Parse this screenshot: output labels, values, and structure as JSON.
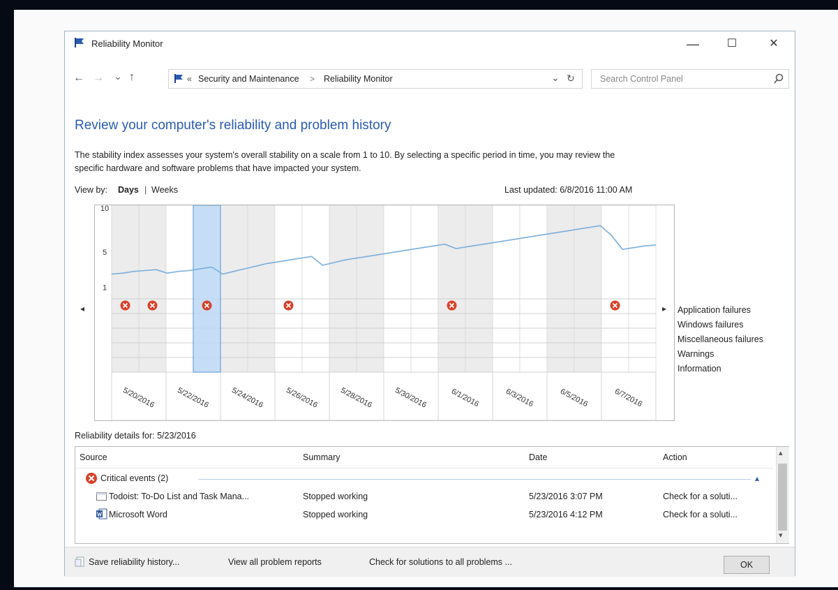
{
  "window": {
    "title": "Reliability Monitor",
    "minimize": "—",
    "maximize": "☐",
    "close": "✕"
  },
  "nav": {
    "back": "←",
    "forward": "→",
    "recent": "⌄",
    "up": "↑",
    "breadcrumb": [
      "Security and Maintenance",
      "Reliability Monitor"
    ],
    "breadcrumb_prefix": "«",
    "separator": ">",
    "dropdown": "⌄",
    "refresh": "↻",
    "search_placeholder": "Search Control Panel"
  },
  "page": {
    "heading": "Review your computer's reliability and problem history",
    "description_line1": "The stability index assesses your system's overall stability on a scale from 1 to 10. By selecting a specific period in time, you may review the",
    "description_line2": "specific hardware and software problems that have impacted your system.",
    "view_by_label": "View by:",
    "view_days": "Days",
    "view_sep": "|",
    "view_weeks": "Weeks",
    "last_updated": "Last updated: 6/8/2016 11:00 AM"
  },
  "chart_data": {
    "type": "line",
    "ylim": [
      0,
      10
    ],
    "y_ticks": [
      "10",
      "5",
      "1"
    ],
    "x_tick_labels": [
      "5/20/2016",
      "5/22/2016",
      "5/24/2016",
      "5/26/2016",
      "5/28/2016",
      "5/30/2016",
      "6/1/2016",
      "6/3/2016",
      "6/5/2016",
      "6/7/2016"
    ],
    "selected_date": "5/23/2016",
    "series": [
      {
        "values": [
          2.5,
          2.6,
          2.8,
          2.9,
          3.0,
          2.6,
          2.8,
          2.9,
          3.1,
          3.3,
          2.5,
          2.8,
          3.1,
          3.4,
          3.7,
          3.9,
          4.1,
          4.3,
          4.5,
          3.5,
          3.8,
          4.1,
          4.3,
          4.5,
          4.7,
          4.9,
          5.1,
          5.3,
          5.5,
          5.7,
          5.9,
          5.4,
          5.6,
          5.8,
          6.0,
          6.2,
          6.4,
          6.6,
          6.8,
          7.0,
          7.2,
          7.4,
          7.6,
          7.8,
          8.0,
          6.9,
          5.3,
          5.5,
          5.7,
          5.8
        ]
      }
    ],
    "event_rows": [
      "Application failures",
      "Windows failures",
      "Miscellaneous failures",
      "Warnings",
      "Information"
    ],
    "application_failure_columns": [
      0,
      1,
      3,
      6,
      12,
      18
    ]
  },
  "chart_nav": {
    "left": "◂",
    "right": "▸"
  },
  "details": {
    "label": "Reliability details for: 5/23/2016",
    "columns": [
      "Source",
      "Summary",
      "Date",
      "Action"
    ],
    "group": "Critical events (2)",
    "group_collapse": "▴",
    "rows": [
      {
        "source": "Todoist: To-Do List and Task Mana...",
        "summary": "Stopped working",
        "date": "5/23/2016 3:07 PM",
        "action": "Check for a soluti..."
      },
      {
        "source": "Microsoft Word",
        "summary": "Stopped working",
        "date": "5/23/2016 4:12 PM",
        "action": "Check for a soluti..."
      }
    ],
    "scroll_up": "▴",
    "scroll_down": "▾"
  },
  "footer": {
    "save": "Save reliability history...",
    "view_all": "View all problem reports",
    "check_all": "Check for solutions to all problems ...",
    "ok": "OK"
  },
  "colors": {
    "accent": "#2a5bb0",
    "link": "#1a6fc4",
    "line": "#7aafdd",
    "error": "#d9412b",
    "selected": "#cfe3f7"
  }
}
